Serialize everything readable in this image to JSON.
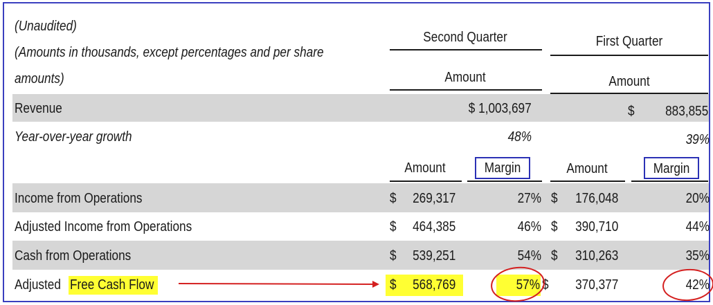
{
  "header": {
    "note_line1": "(Unaudited)",
    "note_line2": "(Amounts in thousands, except percentages and per share",
    "note_line3": "amounts)",
    "period1": "Second Quarter",
    "period2": "First Quarter",
    "amount_label": "Amount"
  },
  "revenue": {
    "label": "Revenue",
    "q2": "$ 1,003,697",
    "q1_sign": "$",
    "q1": "883,855"
  },
  "growth": {
    "label": "Year-over-year growth",
    "q2": "48%",
    "q1": "39%"
  },
  "subheader": {
    "amount": "Amount",
    "margin": "Margin"
  },
  "rows": [
    {
      "label": "Income from Operations",
      "q2_sign": "$",
      "q2_amount": "269,317",
      "q2_margin": "27%",
      "q1_sign": "$",
      "q1_amount": "176,048",
      "q1_margin": "20%"
    },
    {
      "label": "Adjusted Income from Operations",
      "q2_sign": "$",
      "q2_amount": "464,385",
      "q2_margin": "46%",
      "q1_sign": "$",
      "q1_amount": "390,710",
      "q1_margin": "44%"
    },
    {
      "label": "Cash from Operations",
      "q2_sign": "$",
      "q2_amount": "539,251",
      "q2_margin": "54%",
      "q1_sign": "$",
      "q1_amount": "310,263",
      "q1_margin": "35%"
    },
    {
      "label_prefix": "Adjusted",
      "label_highlight": "Free Cash Flow",
      "q2_sign": "$",
      "q2_amount": "568,769",
      "q2_margin": "57%",
      "q1_sign": "$",
      "q1_amount": "370,377",
      "q1_margin": "42%"
    }
  ],
  "colors": {
    "highlight": "#ffff33",
    "band": "#d6d6d6",
    "frame": "#3a3fbf",
    "annotation": "#d42020"
  }
}
